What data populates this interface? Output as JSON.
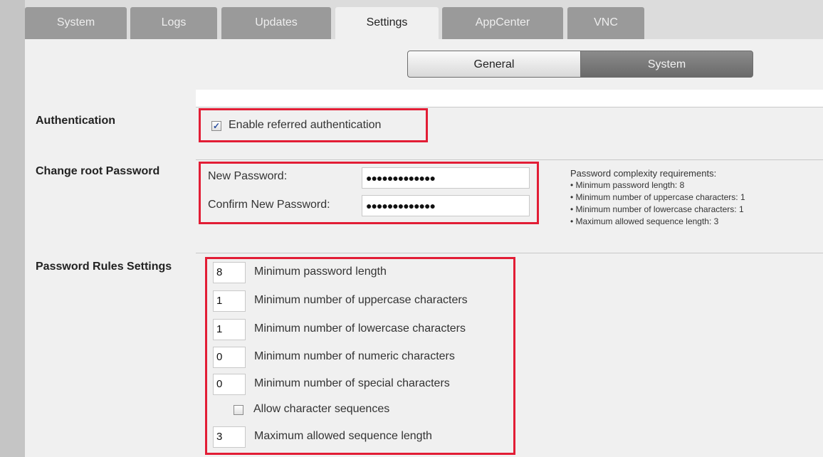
{
  "tabs": [
    "System",
    "Logs",
    "Updates",
    "Settings",
    "AppCenter",
    "VNC"
  ],
  "active_tab": "Settings",
  "segments": {
    "general": "General",
    "system": "System",
    "active": "System"
  },
  "authentication": {
    "section_label": "Authentication",
    "checkbox_label": "Enable referred authentication",
    "checked": true
  },
  "root_password": {
    "section_label": "Change root Password",
    "new_label": "New Password:",
    "new_value": "●●●●●●●●●●●●●",
    "confirm_label": "Confirm New Password:",
    "confirm_value": "●●●●●●●●●●●●●"
  },
  "requirements": {
    "title": "Password complexity requirements:",
    "items": [
      "• Minimum password length: 8",
      "• Minimum number of uppercase characters: 1",
      "• Minimum number of lowercase characters: 1",
      "• Maximum allowed sequence length: 3"
    ]
  },
  "rules": {
    "section_label": "Password Rules Settings",
    "items": [
      {
        "value": "8",
        "label": "Minimum password length"
      },
      {
        "value": "1",
        "label": "Minimum number of uppercase characters"
      },
      {
        "value": "1",
        "label": "Minimum number of lowercase characters"
      },
      {
        "value": "0",
        "label": "Minimum number of numeric characters"
      },
      {
        "value": "0",
        "label": "Minimum number of special characters"
      }
    ],
    "sequences_label": "Allow character sequences",
    "sequences_checked": false,
    "max_seq": {
      "value": "3",
      "label": "Maximum allowed sequence length"
    }
  },
  "colors": {
    "highlight": "#e21d35",
    "active_segment": "#7a7a7a",
    "tab_inactive": "#9a9a9a"
  }
}
